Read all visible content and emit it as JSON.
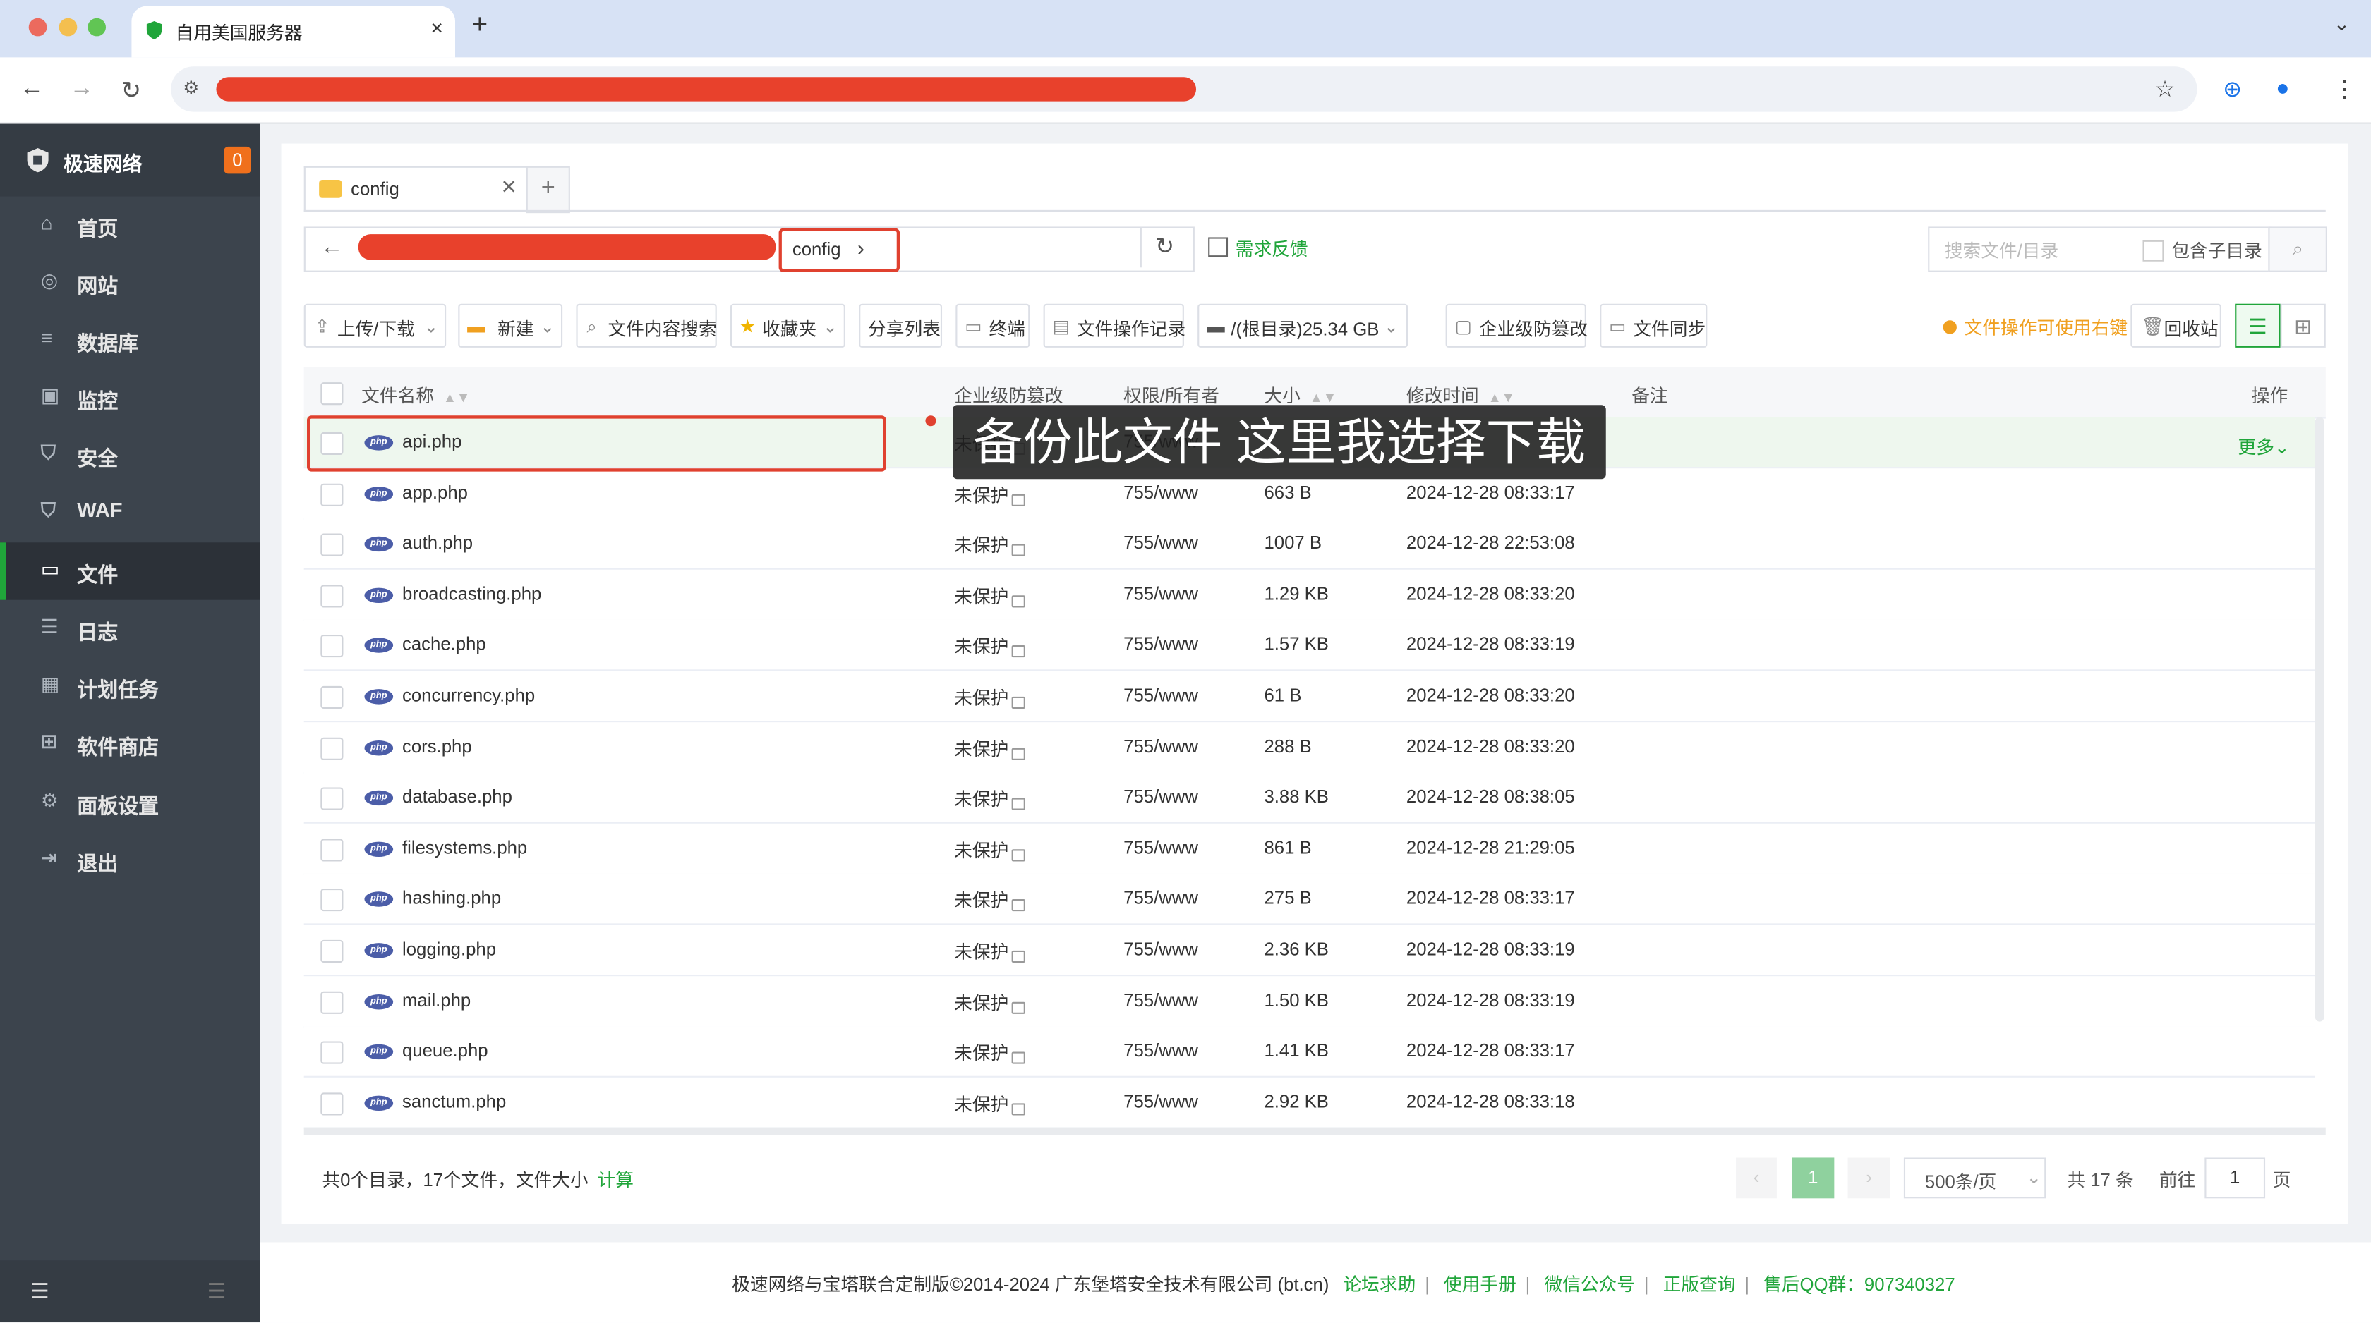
{
  "browser": {
    "tab_title": "自用美国服务器",
    "close_glyph": "×",
    "newtab_glyph": "+",
    "menu_glyph": "⌄"
  },
  "sidebar": {
    "brand": "极速网络",
    "badge": "0",
    "items": [
      {
        "label": "首页",
        "icon": "home-icon"
      },
      {
        "label": "网站",
        "icon": "globe-icon"
      },
      {
        "label": "数据库",
        "icon": "database-icon"
      },
      {
        "label": "监控",
        "icon": "monitor-icon"
      },
      {
        "label": "安全",
        "icon": "shield-icon"
      },
      {
        "label": "WAF",
        "icon": "waf-shield-icon"
      },
      {
        "label": "文件",
        "icon": "folder-icon"
      },
      {
        "label": "日志",
        "icon": "log-icon"
      },
      {
        "label": "计划任务",
        "icon": "calendar-icon"
      },
      {
        "label": "软件商店",
        "icon": "apps-icon"
      },
      {
        "label": "面板设置",
        "icon": "gear-icon"
      },
      {
        "label": "退出",
        "icon": "logout-icon"
      }
    ]
  },
  "files": {
    "tab_label": "config",
    "crumb": "config",
    "feedback": "需求反馈",
    "search_placeholder": "搜索文件/目录",
    "include_subdir": "包含子目录",
    "toolbar": {
      "upload": "上传/下载",
      "new": "新建",
      "content_search": "文件内容搜索",
      "favorites": "收藏夹",
      "share_list": "分享列表",
      "terminal": "终端",
      "op_log": "文件操作记录",
      "disk": "/(根目录)25.34 GB",
      "tamper": "企业级防篡改",
      "sync": "文件同步",
      "hint": "文件操作可使用右键",
      "recycle": "回收站"
    },
    "columns": {
      "name": "文件名称",
      "tamper": "企业级防篡改",
      "perm": "权限/所有者",
      "size": "大小",
      "mtime": "修改时间",
      "note": "备注",
      "action": "操作"
    },
    "rows": [
      {
        "name": "api.php",
        "tamper": "未保护",
        "perm": "755/www",
        "size": "",
        "mtime": ""
      },
      {
        "name": "app.php",
        "tamper": "未保护",
        "perm": "755/www",
        "size": "663 B",
        "mtime": "2024-12-28 08:33:17"
      },
      {
        "name": "auth.php",
        "tamper": "未保护",
        "perm": "755/www",
        "size": "1007 B",
        "mtime": "2024-12-28 22:53:08"
      },
      {
        "name": "broadcasting.php",
        "tamper": "未保护",
        "perm": "755/www",
        "size": "1.29 KB",
        "mtime": "2024-12-28 08:33:20"
      },
      {
        "name": "cache.php",
        "tamper": "未保护",
        "perm": "755/www",
        "size": "1.57 KB",
        "mtime": "2024-12-28 08:33:19"
      },
      {
        "name": "concurrency.php",
        "tamper": "未保护",
        "perm": "755/www",
        "size": "61 B",
        "mtime": "2024-12-28 08:33:20"
      },
      {
        "name": "cors.php",
        "tamper": "未保护",
        "perm": "755/www",
        "size": "288 B",
        "mtime": "2024-12-28 08:33:20"
      },
      {
        "name": "database.php",
        "tamper": "未保护",
        "perm": "755/www",
        "size": "3.88 KB",
        "mtime": "2024-12-28 08:38:05"
      },
      {
        "name": "filesystems.php",
        "tamper": "未保护",
        "perm": "755/www",
        "size": "861 B",
        "mtime": "2024-12-28 21:29:05"
      },
      {
        "name": "hashing.php",
        "tamper": "未保护",
        "perm": "755/www",
        "size": "275 B",
        "mtime": "2024-12-28 08:33:17"
      },
      {
        "name": "logging.php",
        "tamper": "未保护",
        "perm": "755/www",
        "size": "2.36 KB",
        "mtime": "2024-12-28 08:33:19"
      },
      {
        "name": "mail.php",
        "tamper": "未保护",
        "perm": "755/www",
        "size": "1.50 KB",
        "mtime": "2024-12-28 08:33:19"
      },
      {
        "name": "queue.php",
        "tamper": "未保护",
        "perm": "755/www",
        "size": "1.41 KB",
        "mtime": "2024-12-28 08:33:17"
      },
      {
        "name": "sanctum.php",
        "tamper": "未保护",
        "perm": "755/www",
        "size": "2.92 KB",
        "mtime": "2024-12-28 08:33:18"
      }
    ],
    "more": "更多",
    "caption": "备份此文件 这里我选择下载",
    "summary": "共0个目录，17个文件，文件大小",
    "calc": "计算",
    "pagination": {
      "current": "1",
      "per_page": "500条/页",
      "total": "共 17 条",
      "goto": "前往",
      "goto_value": "1",
      "page_unit": "页"
    }
  },
  "footer": {
    "copyright": "极速网络与宝塔联合定制版©2014-2024 广东堡塔安全技术有限公司 (bt.cn)",
    "links": [
      "论坛求助",
      "使用手册",
      "微信公众号",
      "正版查询",
      "售后QQ群：907340327"
    ]
  },
  "colors": {
    "accent": "#20a53a",
    "sidebar": "#3c444d",
    "redact": "#e8412c",
    "warning": "#f0a020"
  }
}
